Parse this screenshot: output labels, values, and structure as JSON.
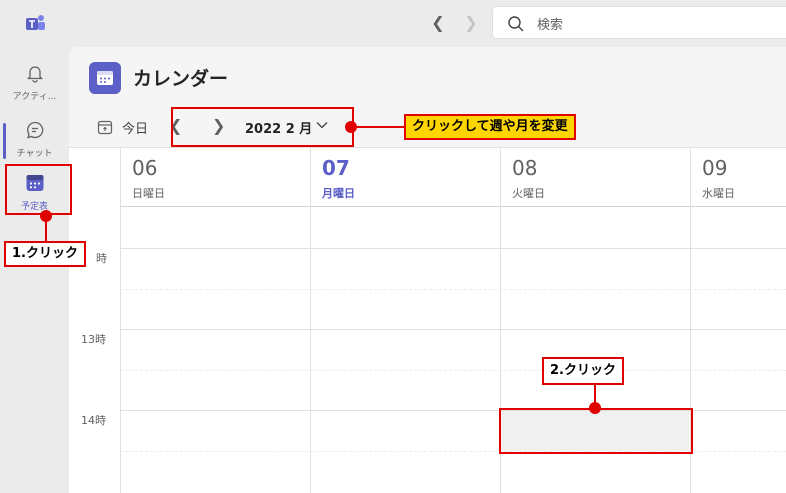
{
  "titlebar": {
    "search_placeholder": "検索",
    "back_icon": "chevron-left-icon",
    "forward_icon": "chevron-right-icon"
  },
  "rail": {
    "items": [
      {
        "label": "アクティ...",
        "icon": "bell-icon"
      },
      {
        "label": "チャット",
        "icon": "chat-icon"
      },
      {
        "label": "予定表",
        "icon": "calendar-icon",
        "active": true
      }
    ]
  },
  "calendar": {
    "title": "カレンダー",
    "today_label": "今日",
    "month_label": "2022 2 月",
    "days": [
      {
        "num": "06",
        "name": "日曜日"
      },
      {
        "num": "07",
        "name": "月曜日",
        "today": true
      },
      {
        "num": "08",
        "name": "火曜日"
      },
      {
        "num": "09",
        "name": "水曜日"
      }
    ],
    "times": [
      "時",
      "13時",
      "14時"
    ]
  },
  "annotations": {
    "change_label": "クリックして週や月を変更",
    "step1_label": "1.クリック",
    "step2_label": "2.クリック"
  },
  "colors": {
    "accent": "#5b5fc7",
    "annotation_red": "#e00000",
    "annotation_yellow": "#ffd500"
  }
}
